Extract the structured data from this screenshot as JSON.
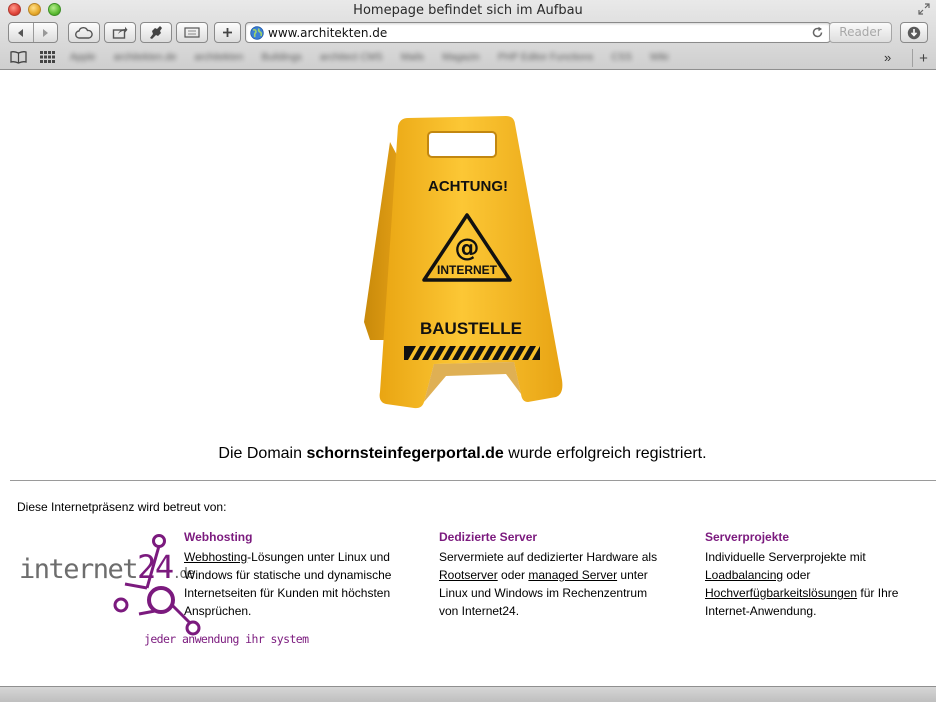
{
  "window": {
    "title": "Homepage befindet sich im Aufbau"
  },
  "toolbar": {
    "url": "www.architekten.de",
    "reader_label": "Reader",
    "new_tab_label": "+",
    "overflow_label": "»"
  },
  "bookmarks": [
    "Apple",
    "architekten.de",
    "architekten",
    "Buildings",
    "architect CMS",
    "Mails",
    "Magazin",
    "PHP Editor Functions",
    "CSS",
    "Wiki"
  ],
  "page": {
    "sign": {
      "top_text": "ACHTUNG!",
      "at_symbol": "@",
      "middle_text": "INTERNET",
      "bottom_text": "BAUSTELLE"
    },
    "domain_prefix": "Die Domain ",
    "domain_name": "schornsteinfegerportal.de",
    "domain_suffix": " wurde erfolgreich registriert.",
    "managed_by": "Diese Internetpräsenz wird betreut von:",
    "logo": {
      "name_a": "internet",
      "name_b": "24",
      "name_c": ".de",
      "tagline": "jeder anwendung ihr system"
    },
    "columns": [
      {
        "heading": "Webhosting",
        "link1": "Webhosting",
        "text1": "-Lösungen unter Linux und Windows für statische und dynamische Internetseiten für Kunden mit höchsten Ansprüchen."
      },
      {
        "heading": "Dedizierte Server",
        "text1": "Servermiete auf dedizierter Hardware als ",
        "link1": "Rootserver",
        "text2": " oder ",
        "link2": "managed Server",
        "text3": " unter Linux und Windows im Rechenzentrum von Internet24."
      },
      {
        "heading": "Serverprojekte",
        "text1": "Individuelle Serverprojekte mit ",
        "link1": "Loadbalancing",
        "text2": " oder ",
        "link2": "Hochverfügbarkeitslösungen",
        "text3": " für Ihre Internet-Anwendung."
      }
    ]
  },
  "colors": {
    "accent_purple": "#7b1a7e",
    "sign_yellow": "#f4b71d",
    "logo_gray": "#6d6d6d"
  }
}
